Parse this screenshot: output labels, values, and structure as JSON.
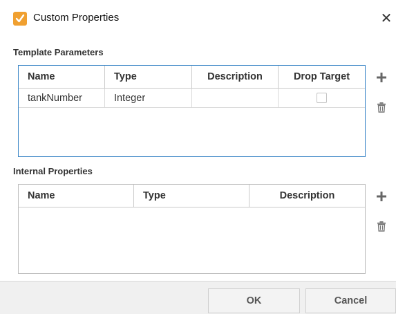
{
  "window": {
    "title": "Custom Properties",
    "icon": "ignition-designer-icon",
    "close_label": "✕"
  },
  "template_parameters": {
    "label": "Template Parameters",
    "columns": [
      "Name",
      "Type",
      "Description",
      "Drop Target"
    ],
    "rows": [
      {
        "name": "tankNumber",
        "type": "Integer",
        "description": "",
        "drop_target": false
      }
    ]
  },
  "internal_properties": {
    "label": "Internal Properties",
    "columns": [
      "Name",
      "Type",
      "Description"
    ],
    "rows": []
  },
  "side_actions": {
    "add_icon": "plus-icon",
    "delete_icon": "trash-icon"
  },
  "footer": {
    "ok_label": "OK",
    "cancel_label": "Cancel"
  },
  "colors": {
    "accent_border": "#3b86c7",
    "icon_bg": "#f0a030",
    "footer_bg": "#f0f0f0"
  }
}
